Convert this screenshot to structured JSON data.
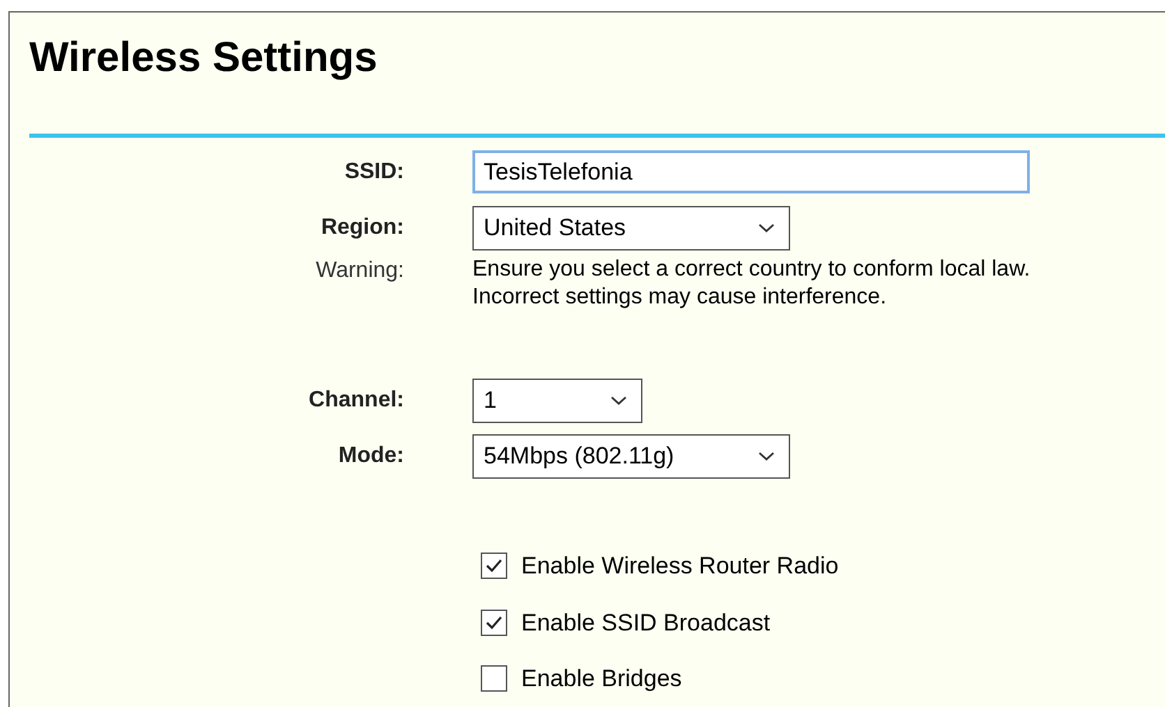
{
  "title": "Wireless Settings",
  "fields": [
    {
      "kind": "text",
      "label": "SSID:",
      "value": "TesisTelefonia"
    },
    {
      "kind": "select",
      "label": "Region:",
      "value": "United States"
    },
    {
      "kind": "note",
      "label": "Warning:",
      "lines": [
        "Ensure you select a correct country to conform local law.",
        "Incorrect settings may cause interference."
      ]
    },
    {
      "kind": "select",
      "label": "Channel:",
      "value": "1"
    },
    {
      "kind": "select",
      "label": "Mode:",
      "value": "54Mbps (802.11g)"
    }
  ],
  "options": [
    {
      "label": "Enable Wireless Router Radio",
      "checked": true
    },
    {
      "label": "Enable SSID Broadcast",
      "checked": true
    },
    {
      "label": "Enable Bridges",
      "checked": false
    }
  ]
}
